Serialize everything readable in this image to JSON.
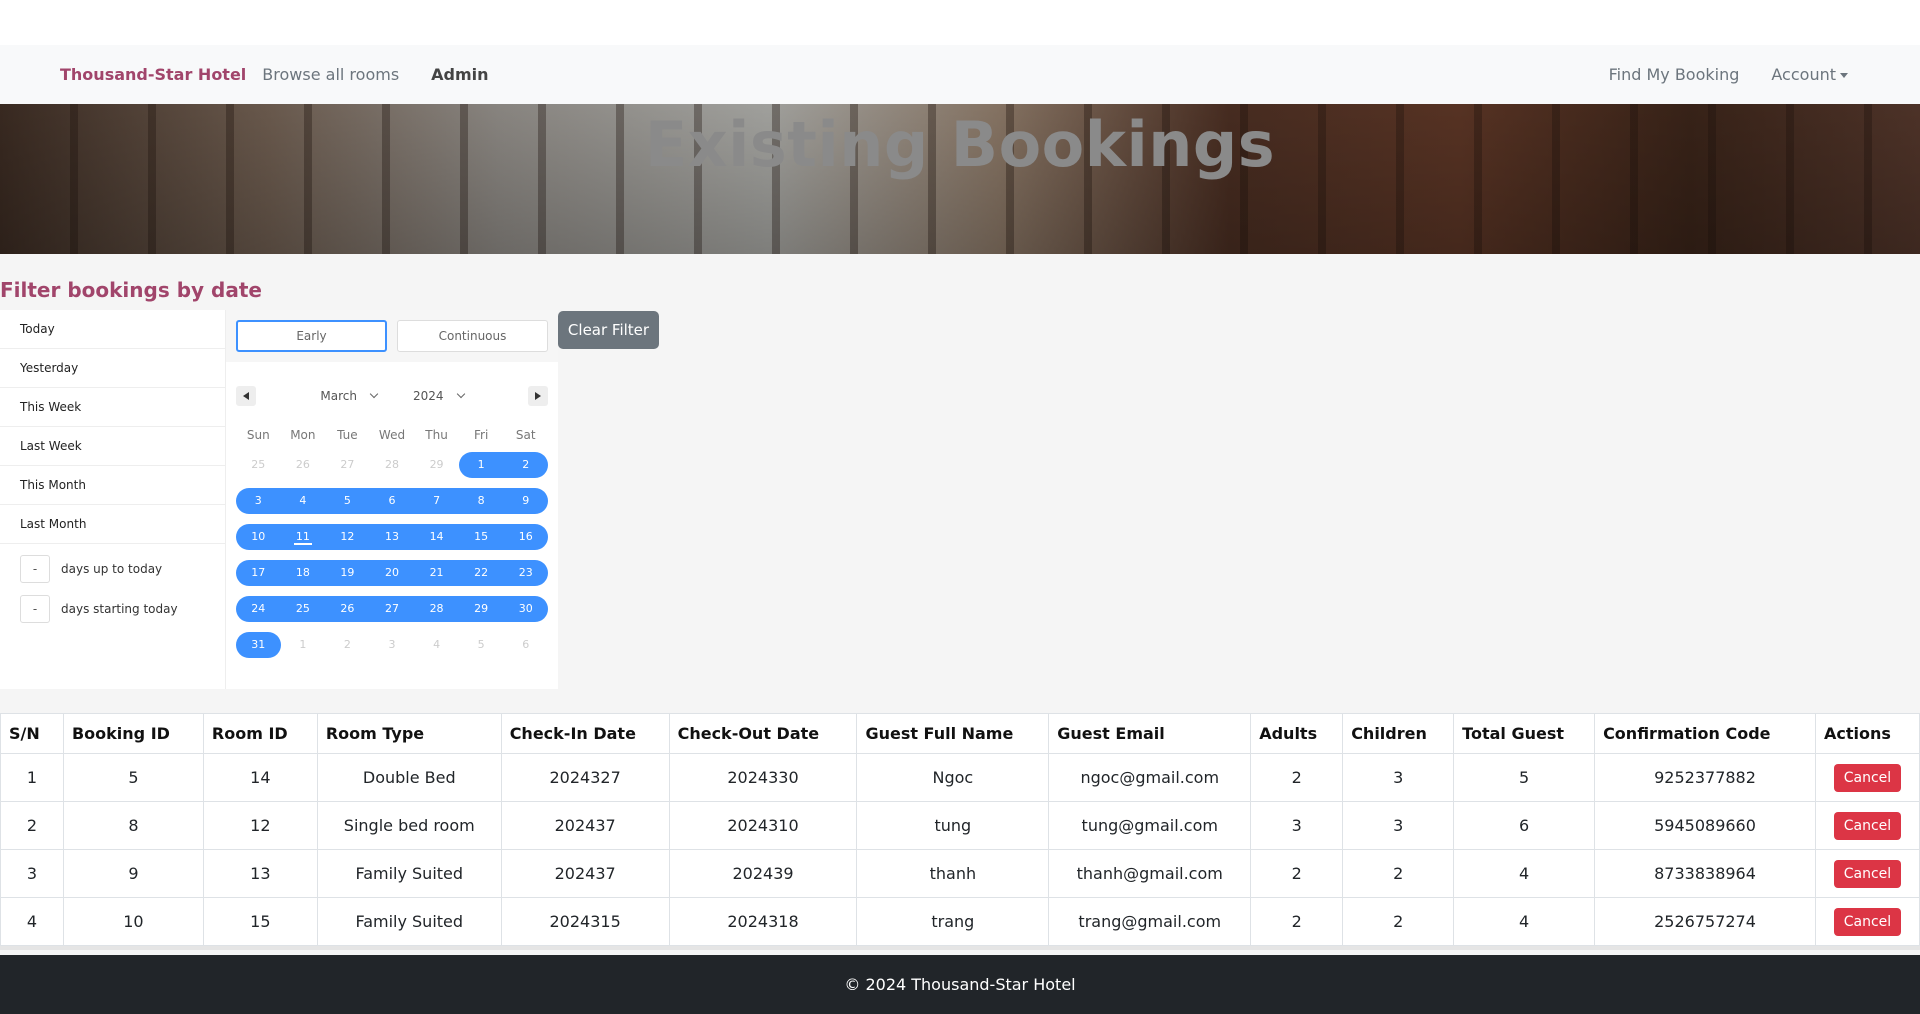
{
  "navbar": {
    "brand": "Thousand-Star Hotel",
    "browse": "Browse all rooms",
    "admin": "Admin",
    "find_booking": "Find My Booking",
    "account": "Account"
  },
  "hero": {
    "title": "Existing Bookings"
  },
  "filter": {
    "title": "Filter bookings by date",
    "ranges": [
      "Today",
      "Yesterday",
      "This Week",
      "Last Week",
      "This Month",
      "Last Month"
    ],
    "days_up": {
      "value": "-",
      "label": "days up to today"
    },
    "days_start": {
      "value": "-",
      "label": "days starting today"
    },
    "tabs": [
      "Early",
      "Continuous"
    ],
    "month": "March",
    "year": "2024",
    "weekdays": [
      "Sun",
      "Mon",
      "Tue",
      "Wed",
      "Thu",
      "Fri",
      "Sat"
    ],
    "clear_label": "Clear Filter",
    "accent_color": "#3d91ff",
    "calendar": [
      {
        "d": "25",
        "in": false
      },
      {
        "d": "26",
        "in": false
      },
      {
        "d": "27",
        "in": false
      },
      {
        "d": "28",
        "in": false
      },
      {
        "d": "29",
        "in": false
      },
      {
        "d": "1",
        "in": true
      },
      {
        "d": "2",
        "in": true
      },
      {
        "d": "3",
        "in": true
      },
      {
        "d": "4",
        "in": true
      },
      {
        "d": "5",
        "in": true
      },
      {
        "d": "6",
        "in": true
      },
      {
        "d": "7",
        "in": true
      },
      {
        "d": "8",
        "in": true
      },
      {
        "d": "9",
        "in": true
      },
      {
        "d": "10",
        "in": true
      },
      {
        "d": "11",
        "in": true,
        "today": true
      },
      {
        "d": "12",
        "in": true
      },
      {
        "d": "13",
        "in": true
      },
      {
        "d": "14",
        "in": true
      },
      {
        "d": "15",
        "in": true
      },
      {
        "d": "16",
        "in": true
      },
      {
        "d": "17",
        "in": true
      },
      {
        "d": "18",
        "in": true
      },
      {
        "d": "19",
        "in": true
      },
      {
        "d": "20",
        "in": true
      },
      {
        "d": "21",
        "in": true
      },
      {
        "d": "22",
        "in": true
      },
      {
        "d": "23",
        "in": true
      },
      {
        "d": "24",
        "in": true
      },
      {
        "d": "25",
        "in": true
      },
      {
        "d": "26",
        "in": true
      },
      {
        "d": "27",
        "in": true
      },
      {
        "d": "28",
        "in": true
      },
      {
        "d": "29",
        "in": true
      },
      {
        "d": "30",
        "in": true
      },
      {
        "d": "31",
        "in": true
      },
      {
        "d": "1",
        "in": false
      },
      {
        "d": "2",
        "in": false
      },
      {
        "d": "3",
        "in": false
      },
      {
        "d": "4",
        "in": false
      },
      {
        "d": "5",
        "in": false
      },
      {
        "d": "6",
        "in": false
      }
    ]
  },
  "table": {
    "headers": [
      "S/N",
      "Booking ID",
      "Room ID",
      "Room Type",
      "Check-In Date",
      "Check-Out Date",
      "Guest Full Name",
      "Guest Email",
      "Adults",
      "Children",
      "Total Guest",
      "Confirmation Code",
      "Actions"
    ],
    "cancel_label": "Cancel",
    "rows": [
      [
        "1",
        "5",
        "14",
        "Double Bed",
        "2024327",
        "2024330",
        "Ngoc",
        "ngoc@gmail.com",
        "2",
        "3",
        "5",
        "9252377882"
      ],
      [
        "2",
        "8",
        "12",
        "Single bed room",
        "202437",
        "2024310",
        "tung",
        "tung@gmail.com",
        "3",
        "3",
        "6",
        "5945089660"
      ],
      [
        "3",
        "9",
        "13",
        "Family Suited",
        "202437",
        "202439",
        "thanh",
        "thanh@gmail.com",
        "2",
        "2",
        "4",
        "8733838964"
      ],
      [
        "4",
        "10",
        "15",
        "Family Suited",
        "2024315",
        "2024318",
        "trang",
        "trang@gmail.com",
        "2",
        "2",
        "4",
        "2526757274"
      ]
    ]
  },
  "footer": {
    "text": "© 2024 Thousand-Star Hotel"
  }
}
